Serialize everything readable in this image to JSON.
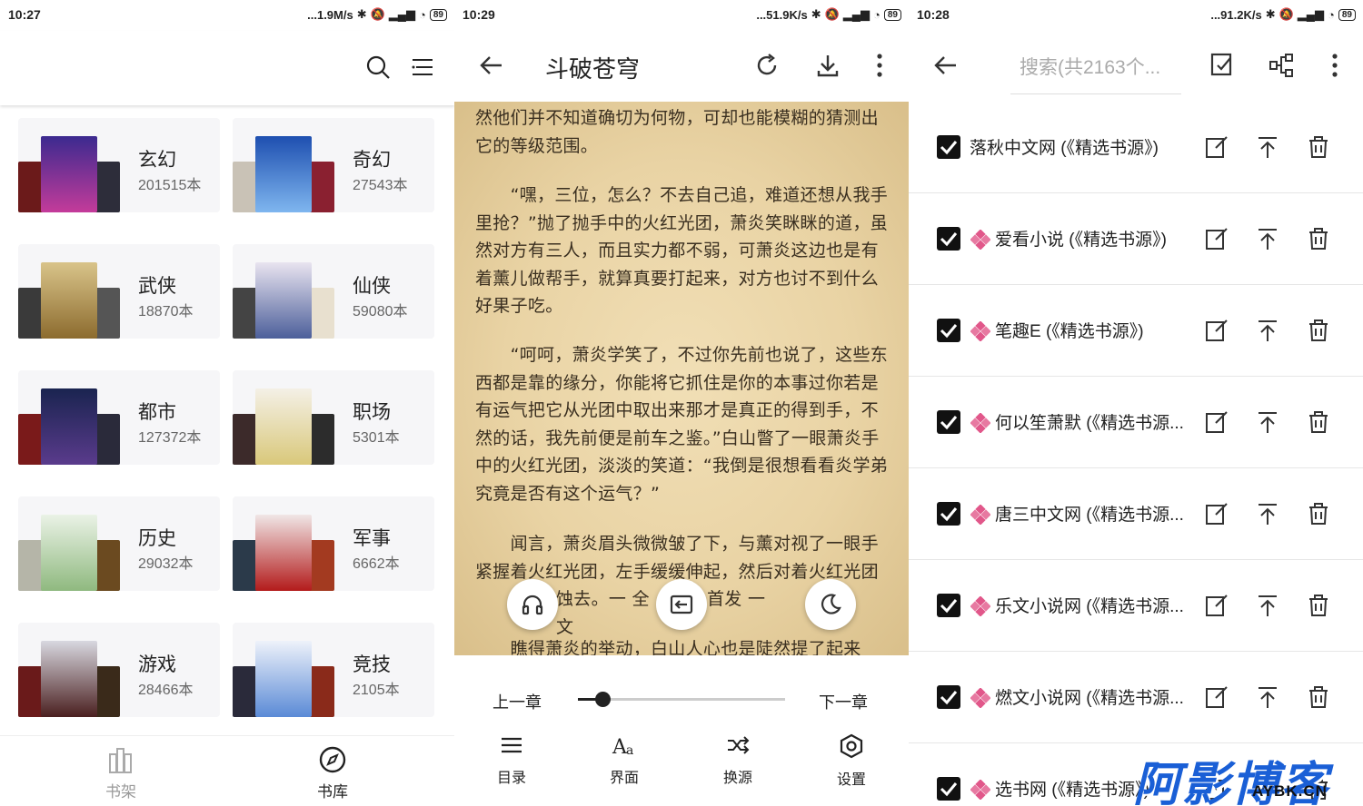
{
  "panel1": {
    "status": {
      "time": "10:27",
      "speed": "...1.9M/s",
      "battery": "89"
    },
    "categories": [
      {
        "name": "玄幻",
        "count": "201515本"
      },
      {
        "name": "奇幻",
        "count": "27543本"
      },
      {
        "name": "武侠",
        "count": "18870本"
      },
      {
        "name": "仙侠",
        "count": "59080本"
      },
      {
        "name": "都市",
        "count": "127372本"
      },
      {
        "name": "职场",
        "count": "5301本"
      },
      {
        "name": "历史",
        "count": "29032本"
      },
      {
        "name": "军事",
        "count": "6662本"
      },
      {
        "name": "游戏",
        "count": "28466本"
      },
      {
        "name": "竞技",
        "count": "2105本"
      }
    ],
    "nav": {
      "shelf": "书架",
      "library": "书库"
    }
  },
  "panel2": {
    "status": {
      "time": "10:29",
      "speed": "...51.9K/s",
      "battery": "89"
    },
    "title": "斗破苍穹",
    "paragraphs": [
      "然他们并不知道确切为何物，可却也能模糊的猜测出它的等级范围。",
      "　　“嘿，三位，怎么？不去自己追，难道还想从我手里抢？”抛了抛手中的火红光团，萧炎笑眯眯的道，虽然对方有三人，而且实力都不弱，可萧炎这边也是有着薰儿做帮手，就算真要打起来，对方也讨不到什么好果子吃。",
      "　　“呵呵，萧炎学笑了，不过你先前也说了，这些东西都是靠的缘分，你能将它抓住是你的本事过你若是有运气把它从光团中取出来那才是真正的得到手，不然的话，我先前便是前车之鉴。”白山瞥了一眼萧炎手中的火红光团，淡淡的笑道：“我倒是很想看看炎学弟究竟是否有这个运气？”",
      "　　闻言，萧炎眉头微微皱了下，与薰对视了一眼手紧握着火红光团，左手缓缓伸起，然后对着火红光团",
      "　　瞧得萧炎的举动，白山人心也是陡然提了起来"
    ],
    "tts_line": "蚀去。一 全文",
    "tts_line_tail": "首发 一",
    "prev_chapter": "上一章",
    "next_chapter": "下一章",
    "progress": 0.12,
    "controls": {
      "toc": "目录",
      "ui": "界面",
      "source": "换源",
      "settings": "设置"
    }
  },
  "panel3": {
    "status": {
      "time": "10:28",
      "speed": "...91.2K/s",
      "battery": "89"
    },
    "search_placeholder": "搜索(共2163个...",
    "sources": [
      {
        "name": "落秋中文网 (《精选书源》)",
        "icon": false
      },
      {
        "name": "爱看小说 (《精选书源》)",
        "icon": true
      },
      {
        "name": "笔趣E (《精选书源》)",
        "icon": true
      },
      {
        "name": "何以笙萧默 (《精选书源...",
        "icon": true
      },
      {
        "name": "唐三中文网 (《精选书源...",
        "icon": true
      },
      {
        "name": "乐文小说网 (《精选书源...",
        "icon": true
      },
      {
        "name": "燃文小说网 (《精选书源...",
        "icon": true
      },
      {
        "name": "选书网 (《精选书源》)",
        "icon": true
      }
    ],
    "watermark": "阿影博客",
    "watermark_sub": "AYBK.CN",
    "accent": "#e1578a"
  }
}
